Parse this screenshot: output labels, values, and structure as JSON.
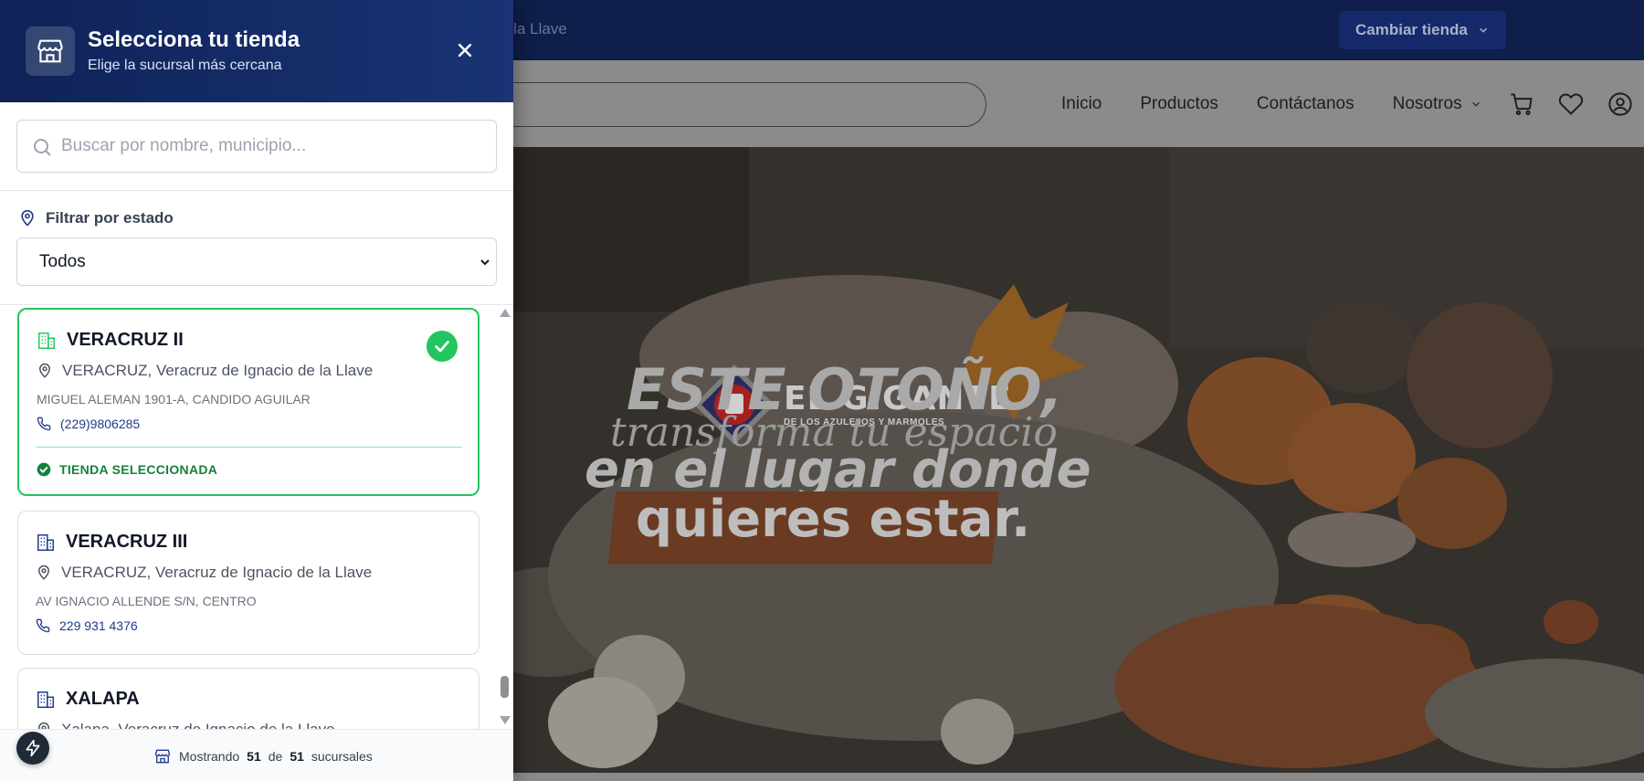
{
  "topbar": {
    "location_text": "e la Llave",
    "change_store_label": "Cambiar tienda"
  },
  "nav": {
    "links": [
      "Inicio",
      "Productos",
      "Contáctanos",
      "Nosotros"
    ]
  },
  "hero": {
    "logo_name": "EL GIGANTE",
    "logo_sub": "DE LOS AZULEJOS Y MARMOLES",
    "line1": "ESTE OTOÑO,",
    "line2": "transforma tu espacio",
    "line3": "en el lugar donde",
    "line4": "quieres estar."
  },
  "panel": {
    "title": "Selecciona tu tienda",
    "subtitle": "Elige la sucursal más cercana",
    "search_placeholder": "Buscar por nombre, municipio...",
    "filter_label": "Filtrar por estado",
    "filter_value": "Todos",
    "stores": [
      {
        "name": "VERACRUZ II",
        "city": "VERACRUZ, Veracruz de Ignacio de la Llave",
        "address": "MIGUEL ALEMAN 1901-A, CANDIDO AGUILAR",
        "phone": "(229)9806285",
        "selected_label": "TIENDA SELECCIONADA"
      },
      {
        "name": "VERACRUZ III",
        "city": "VERACRUZ, Veracruz de Ignacio de la Llave",
        "address": "AV IGNACIO ALLENDE S/N, CENTRO",
        "phone": "229 931 4376"
      },
      {
        "name": "XALAPA",
        "city": "Xalapa, Veracruz de Ignacio de la Llave"
      }
    ],
    "footer": {
      "prefix": "Mostrando",
      "shown": "51",
      "middle": "de",
      "total": "51",
      "suffix": "sucursales"
    }
  },
  "colors": {
    "header_navy": "#0f2358",
    "accent_green": "#22c55e",
    "link_blue": "#1f3a8a"
  },
  "icons": {
    "header": "store-icon",
    "close": "close-icon",
    "search": "search-icon",
    "filter": "map-pin-icon",
    "card": "building-icon",
    "phone": "phone-icon",
    "check": "check-circle-icon",
    "bolt": "bolt-icon"
  }
}
